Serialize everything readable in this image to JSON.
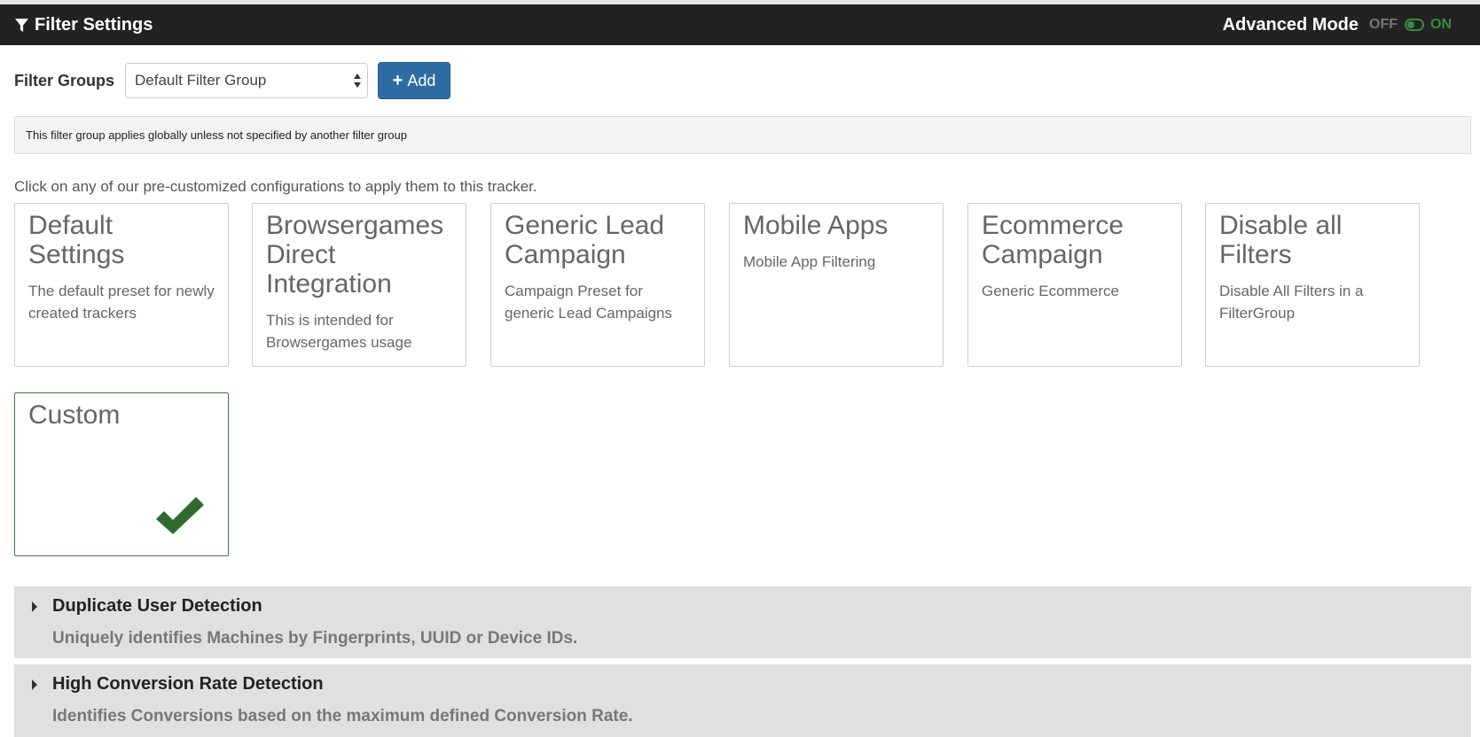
{
  "header": {
    "title": "Filter Settings",
    "advanced_mode_label": "Advanced Mode",
    "toggle_off": "OFF",
    "toggle_on": "ON"
  },
  "filter_groups": {
    "label": "Filter Groups",
    "selected": "Default Filter Group",
    "add_label": "Add"
  },
  "info_text": "This filter group applies globally unless not specified by another filter group",
  "hint_text": "Click on any of our pre-customized configurations to apply them to this tracker.",
  "presets": [
    {
      "title": "Default Settings",
      "desc": "The default preset for newly created trackers"
    },
    {
      "title": "Browsergames Direct Integration",
      "desc": "This is intended for Browsergames usage"
    },
    {
      "title": "Generic Lead Campaign",
      "desc": "Campaign Preset for generic Lead Campaigns"
    },
    {
      "title": "Mobile Apps",
      "desc": "Mobile App Filtering"
    },
    {
      "title": "Ecommerce Campaign",
      "desc": "Generic Ecommerce"
    },
    {
      "title": "Disable all Filters",
      "desc": "Disable All Filters in a FilterGroup"
    },
    {
      "title": "Custom",
      "desc": ""
    }
  ],
  "sections": [
    {
      "title": "Duplicate User Detection",
      "desc": "Uniquely identifies Machines by Fingerprints, UUID or Device IDs."
    },
    {
      "title": "High Conversion Rate Detection",
      "desc": "Identifies Conversions based on the maximum defined Conversion Rate."
    }
  ],
  "colors": {
    "header_bg": "#222222",
    "primary_button": "#2e6da4",
    "toggle_on": "#3c8a3c",
    "check_green": "#2f6b2f"
  }
}
